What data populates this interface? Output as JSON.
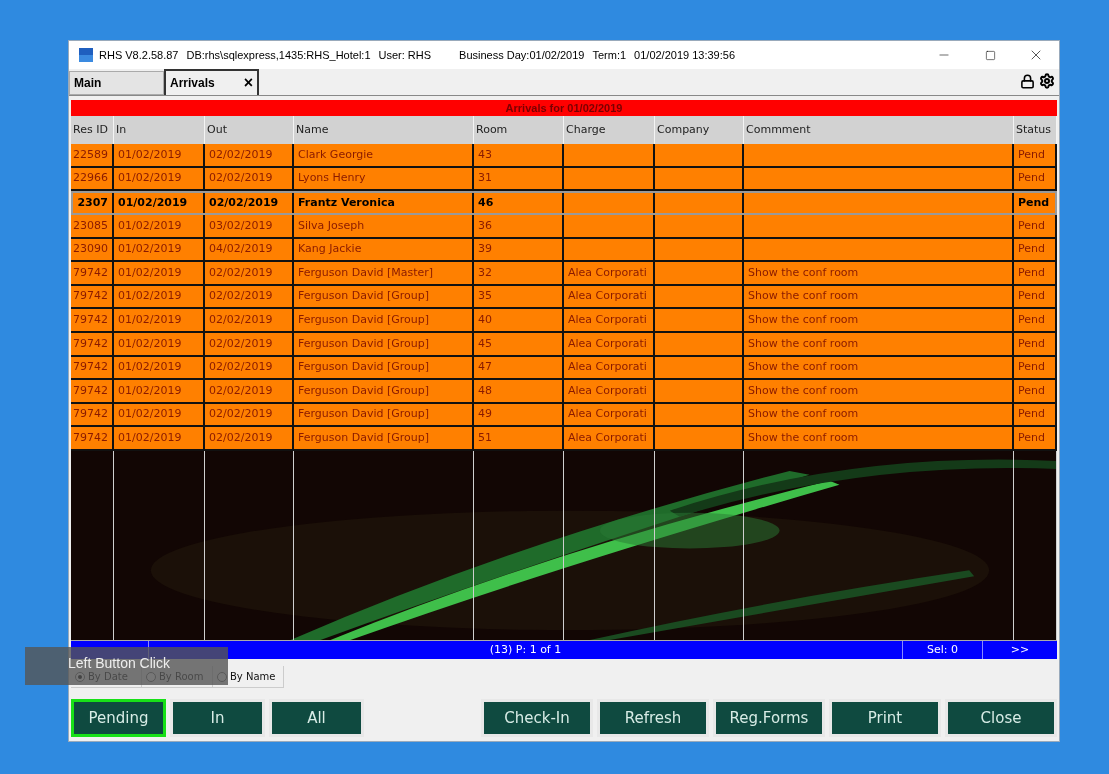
{
  "window": {
    "title_parts": [
      "RHS V8.2.58.87",
      "DB:rhs\\sqlexpress,1435:RHS_Hotel:1",
      "User: RHS",
      "Business Day:01/02/2019",
      "Term:1",
      "01/02/2019 13:39:56"
    ]
  },
  "tabs": [
    {
      "label": "Main",
      "selected": false
    },
    {
      "label": "Arrivals",
      "selected": true,
      "close_glyph": "×"
    }
  ],
  "grid": {
    "title": "Arrivals for 01/02/2019",
    "columns": [
      "Res ID",
      "In",
      "Out",
      "Name",
      "Room",
      "Charge",
      "Company",
      "Commment",
      "Status"
    ],
    "rows": [
      {
        "selected": false,
        "cells": [
          "22589",
          "01/02/2019",
          "02/02/2019",
          "Clark Georgie",
          "43",
          "",
          "",
          "",
          "Pend"
        ]
      },
      {
        "selected": false,
        "cells": [
          "22966",
          "01/02/2019",
          "02/02/2019",
          "Lyons Henry",
          "31",
          "",
          "",
          "",
          "Pend"
        ]
      },
      {
        "selected": true,
        "cells": [
          "2307",
          "01/02/2019",
          "02/02/2019",
          "Frantz Veronica",
          "46",
          "",
          "",
          "",
          "Pend"
        ]
      },
      {
        "selected": false,
        "cells": [
          "23085",
          "01/02/2019",
          "03/02/2019",
          "Silva Joseph",
          "36",
          "",
          "",
          "",
          "Pend"
        ]
      },
      {
        "selected": false,
        "cells": [
          "23090",
          "01/02/2019",
          "04/02/2019",
          "Kang Jackie",
          "39",
          "",
          "",
          "",
          "Pend"
        ]
      },
      {
        "selected": false,
        "cells": [
          "79742",
          "01/02/2019",
          "02/02/2019",
          "Ferguson David [Master]",
          "32",
          "Alea Corporati",
          "",
          "Show the conf room",
          "Pend"
        ]
      },
      {
        "selected": false,
        "cells": [
          "79742",
          "01/02/2019",
          "02/02/2019",
          "Ferguson David [Group]",
          "35",
          "Alea Corporati",
          "",
          "Show the conf room",
          "Pend"
        ]
      },
      {
        "selected": false,
        "cells": [
          "79742",
          "01/02/2019",
          "02/02/2019",
          "Ferguson David [Group]",
          "40",
          "Alea Corporati",
          "",
          "Show the conf room",
          "Pend"
        ]
      },
      {
        "selected": false,
        "cells": [
          "79742",
          "01/02/2019",
          "02/02/2019",
          "Ferguson David [Group]",
          "45",
          "Alea Corporati",
          "",
          "Show the conf room",
          "Pend"
        ]
      },
      {
        "selected": false,
        "cells": [
          "79742",
          "01/02/2019",
          "02/02/2019",
          "Ferguson David [Group]",
          "47",
          "Alea Corporati",
          "",
          "Show the conf room",
          "Pend"
        ]
      },
      {
        "selected": false,
        "cells": [
          "79742",
          "01/02/2019",
          "02/02/2019",
          "Ferguson David [Group]",
          "48",
          "Alea Corporati",
          "",
          "Show the conf room",
          "Pend"
        ]
      },
      {
        "selected": false,
        "cells": [
          "79742",
          "01/02/2019",
          "02/02/2019",
          "Ferguson David [Group]",
          "49",
          "Alea Corporati",
          "",
          "Show the conf room",
          "Pend"
        ]
      },
      {
        "selected": false,
        "cells": [
          "79742",
          "01/02/2019",
          "02/02/2019",
          "Ferguson David [Group]",
          "51",
          "Alea Corporati",
          "",
          "Show the conf room",
          "Pend"
        ]
      }
    ]
  },
  "status_bar": {
    "page": "(13) P: 1 of 1",
    "selection": "Sel: 0",
    "next": ">>"
  },
  "sort_options": [
    {
      "label": "By Date",
      "selected": true
    },
    {
      "label": "By Room",
      "selected": false
    },
    {
      "label": "By Name",
      "selected": false
    }
  ],
  "filter_buttons": [
    {
      "label": "Pending",
      "selected": true
    },
    {
      "label": "In",
      "selected": false
    },
    {
      "label": "All",
      "selected": false
    }
  ],
  "action_buttons": [
    "Check-In",
    "Refresh",
    "Reg.Forms",
    "Print",
    "Close"
  ],
  "overlay": {
    "caption": "Left Button Click"
  }
}
